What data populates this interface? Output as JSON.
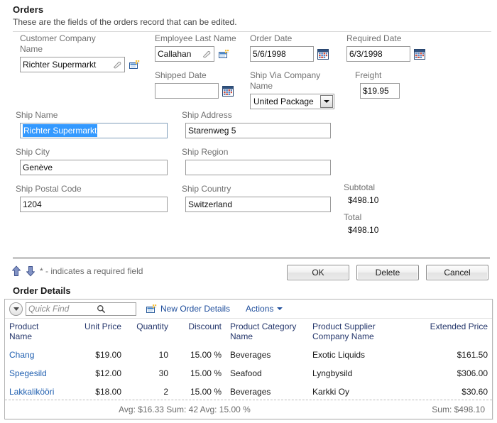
{
  "form": {
    "title": "Orders",
    "description": "These are the fields of the orders record that can be edited."
  },
  "fields": {
    "customer_company_name": {
      "label": "Customer Company\nName",
      "value": "Richter Supermarkt",
      "edit_icon": "pencil-icon",
      "lookup_icon": "lookup-window-icon"
    },
    "employee_last_name": {
      "label": "Employee Last Name",
      "value": "Callahan",
      "edit_icon": "pencil-icon",
      "lookup_icon": "lookup-window-icon"
    },
    "order_date": {
      "label": "Order Date",
      "value": "5/6/1998",
      "picker_icon": "calendar-icon"
    },
    "required_date": {
      "label": "Required Date",
      "value": "6/3/1998",
      "picker_icon": "calendar-icon"
    },
    "shipped_date": {
      "label": "Shipped Date",
      "value": "",
      "picker_icon": "calendar-icon"
    },
    "ship_via_company_name": {
      "label": "Ship Via Company\nName",
      "value": "United Package",
      "dropdown_icon": "chevron-down-icon"
    },
    "freight": {
      "label": "Freight",
      "value": "$19.95"
    },
    "ship_name": {
      "label": "Ship Name",
      "value": "Richter Supermarkt",
      "selected": true
    },
    "ship_address": {
      "label": "Ship Address",
      "value": "Starenweg 5"
    },
    "ship_city": {
      "label": "Ship City",
      "value": "Genève"
    },
    "ship_region": {
      "label": "Ship Region",
      "value": ""
    },
    "ship_postal_code": {
      "label": "Ship Postal Code",
      "value": "1204"
    },
    "ship_country": {
      "label": "Ship Country",
      "value": "Switzerland"
    },
    "subtotal": {
      "label": "Subtotal",
      "value": "$498.10"
    },
    "total": {
      "label": "Total",
      "value": "$498.10"
    }
  },
  "action_bar": {
    "required_note": "* - indicates a required field",
    "required_star": "*",
    "up_icon": "arrow-up-icon",
    "down_icon": "arrow-down-icon",
    "buttons": [
      {
        "label": "OK",
        "name": "ok-button"
      },
      {
        "label": "Delete",
        "name": "delete-button"
      },
      {
        "label": "Cancel",
        "name": "cancel-button"
      }
    ]
  },
  "order_details": {
    "title": "Order Details",
    "toolbar": {
      "quick_find_placeholder": "Quick Find",
      "quick_find_value": "",
      "search_icon": "magnifier-icon",
      "caret_icon": "chevron-down-circle-icon",
      "new_record_label": "New Order Details",
      "new_record_icon": "new-window-icon",
      "actions_label": "Actions",
      "actions_caret_icon": "chevron-down-icon"
    },
    "columns": [
      {
        "label": "Product\nName",
        "align": "left"
      },
      {
        "label": "Unit Price",
        "align": "right"
      },
      {
        "label": "Quantity",
        "align": "right"
      },
      {
        "label": "Discount",
        "align": "right"
      },
      {
        "label": "Product Category\nName",
        "align": "left"
      },
      {
        "label": "Product Supplier\nCompany Name",
        "align": "left"
      },
      {
        "label": "Extended Price",
        "align": "right"
      }
    ],
    "rows": [
      {
        "product_name": "Chang",
        "unit_price": "$19.00",
        "quantity": "10",
        "discount": "15.00 %",
        "category": "Beverages",
        "supplier": "Exotic Liquids",
        "extended_price": "$161.50"
      },
      {
        "product_name": "Spegesild",
        "unit_price": "$12.00",
        "quantity": "30",
        "discount": "15.00 %",
        "category": "Seafood",
        "supplier": "Lyngbysild",
        "extended_price": "$306.00"
      },
      {
        "product_name": "Lakkalikööri",
        "unit_price": "$18.00",
        "quantity": "2",
        "discount": "15.00 %",
        "category": "Beverages",
        "supplier": "Karkki Oy",
        "extended_price": "$30.60"
      }
    ],
    "footer": {
      "aggregate_left": "Avg: $16.33  Sum: 42  Avg: 15.00 %",
      "aggregate_right": "Sum: $498.10"
    }
  },
  "colors": {
    "link": "#1f5fb0",
    "header_text": "#24366b",
    "label": "#707070",
    "selection": "#3399ff",
    "toolbar_link": "#1f4e9c"
  }
}
